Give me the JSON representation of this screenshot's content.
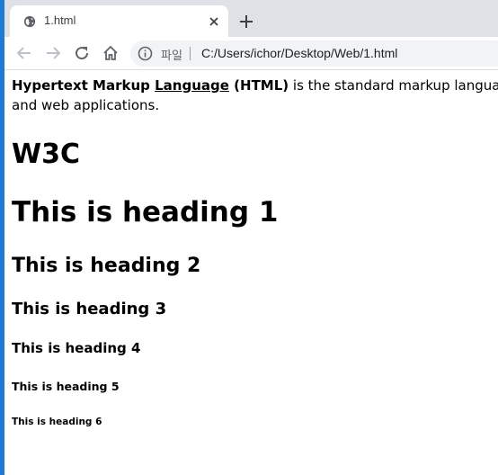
{
  "browser": {
    "tab": {
      "title": "1.html",
      "favicon": "globe-icon"
    },
    "new_tab_icon": "plus-icon",
    "toolbar": {
      "back_icon": "arrow-left-icon",
      "forward_icon": "arrow-right-icon",
      "reload_icon": "reload-icon",
      "home_icon": "home-icon"
    },
    "omnibox": {
      "info_icon": "info-icon",
      "scheme_label": "파일",
      "url": "C:/Users/ichor/Desktop/Web/1.html"
    },
    "accent": "#1f7ad6"
  },
  "page": {
    "intro": {
      "part1": "Hypertext Markup ",
      "part2": "Language",
      "part3": " (HTML)",
      "part4": " is the standard markup language for documents designed to be displayed in a web browser.",
      "line2": "and web applications."
    },
    "w3c": "W3C",
    "headings": {
      "h1": "This is heading 1",
      "h2": "This is heading 2",
      "h3": "This is heading 3",
      "h4": "This is heading 4",
      "h5": "This is heading 5",
      "h6": "This is heading 6"
    }
  }
}
